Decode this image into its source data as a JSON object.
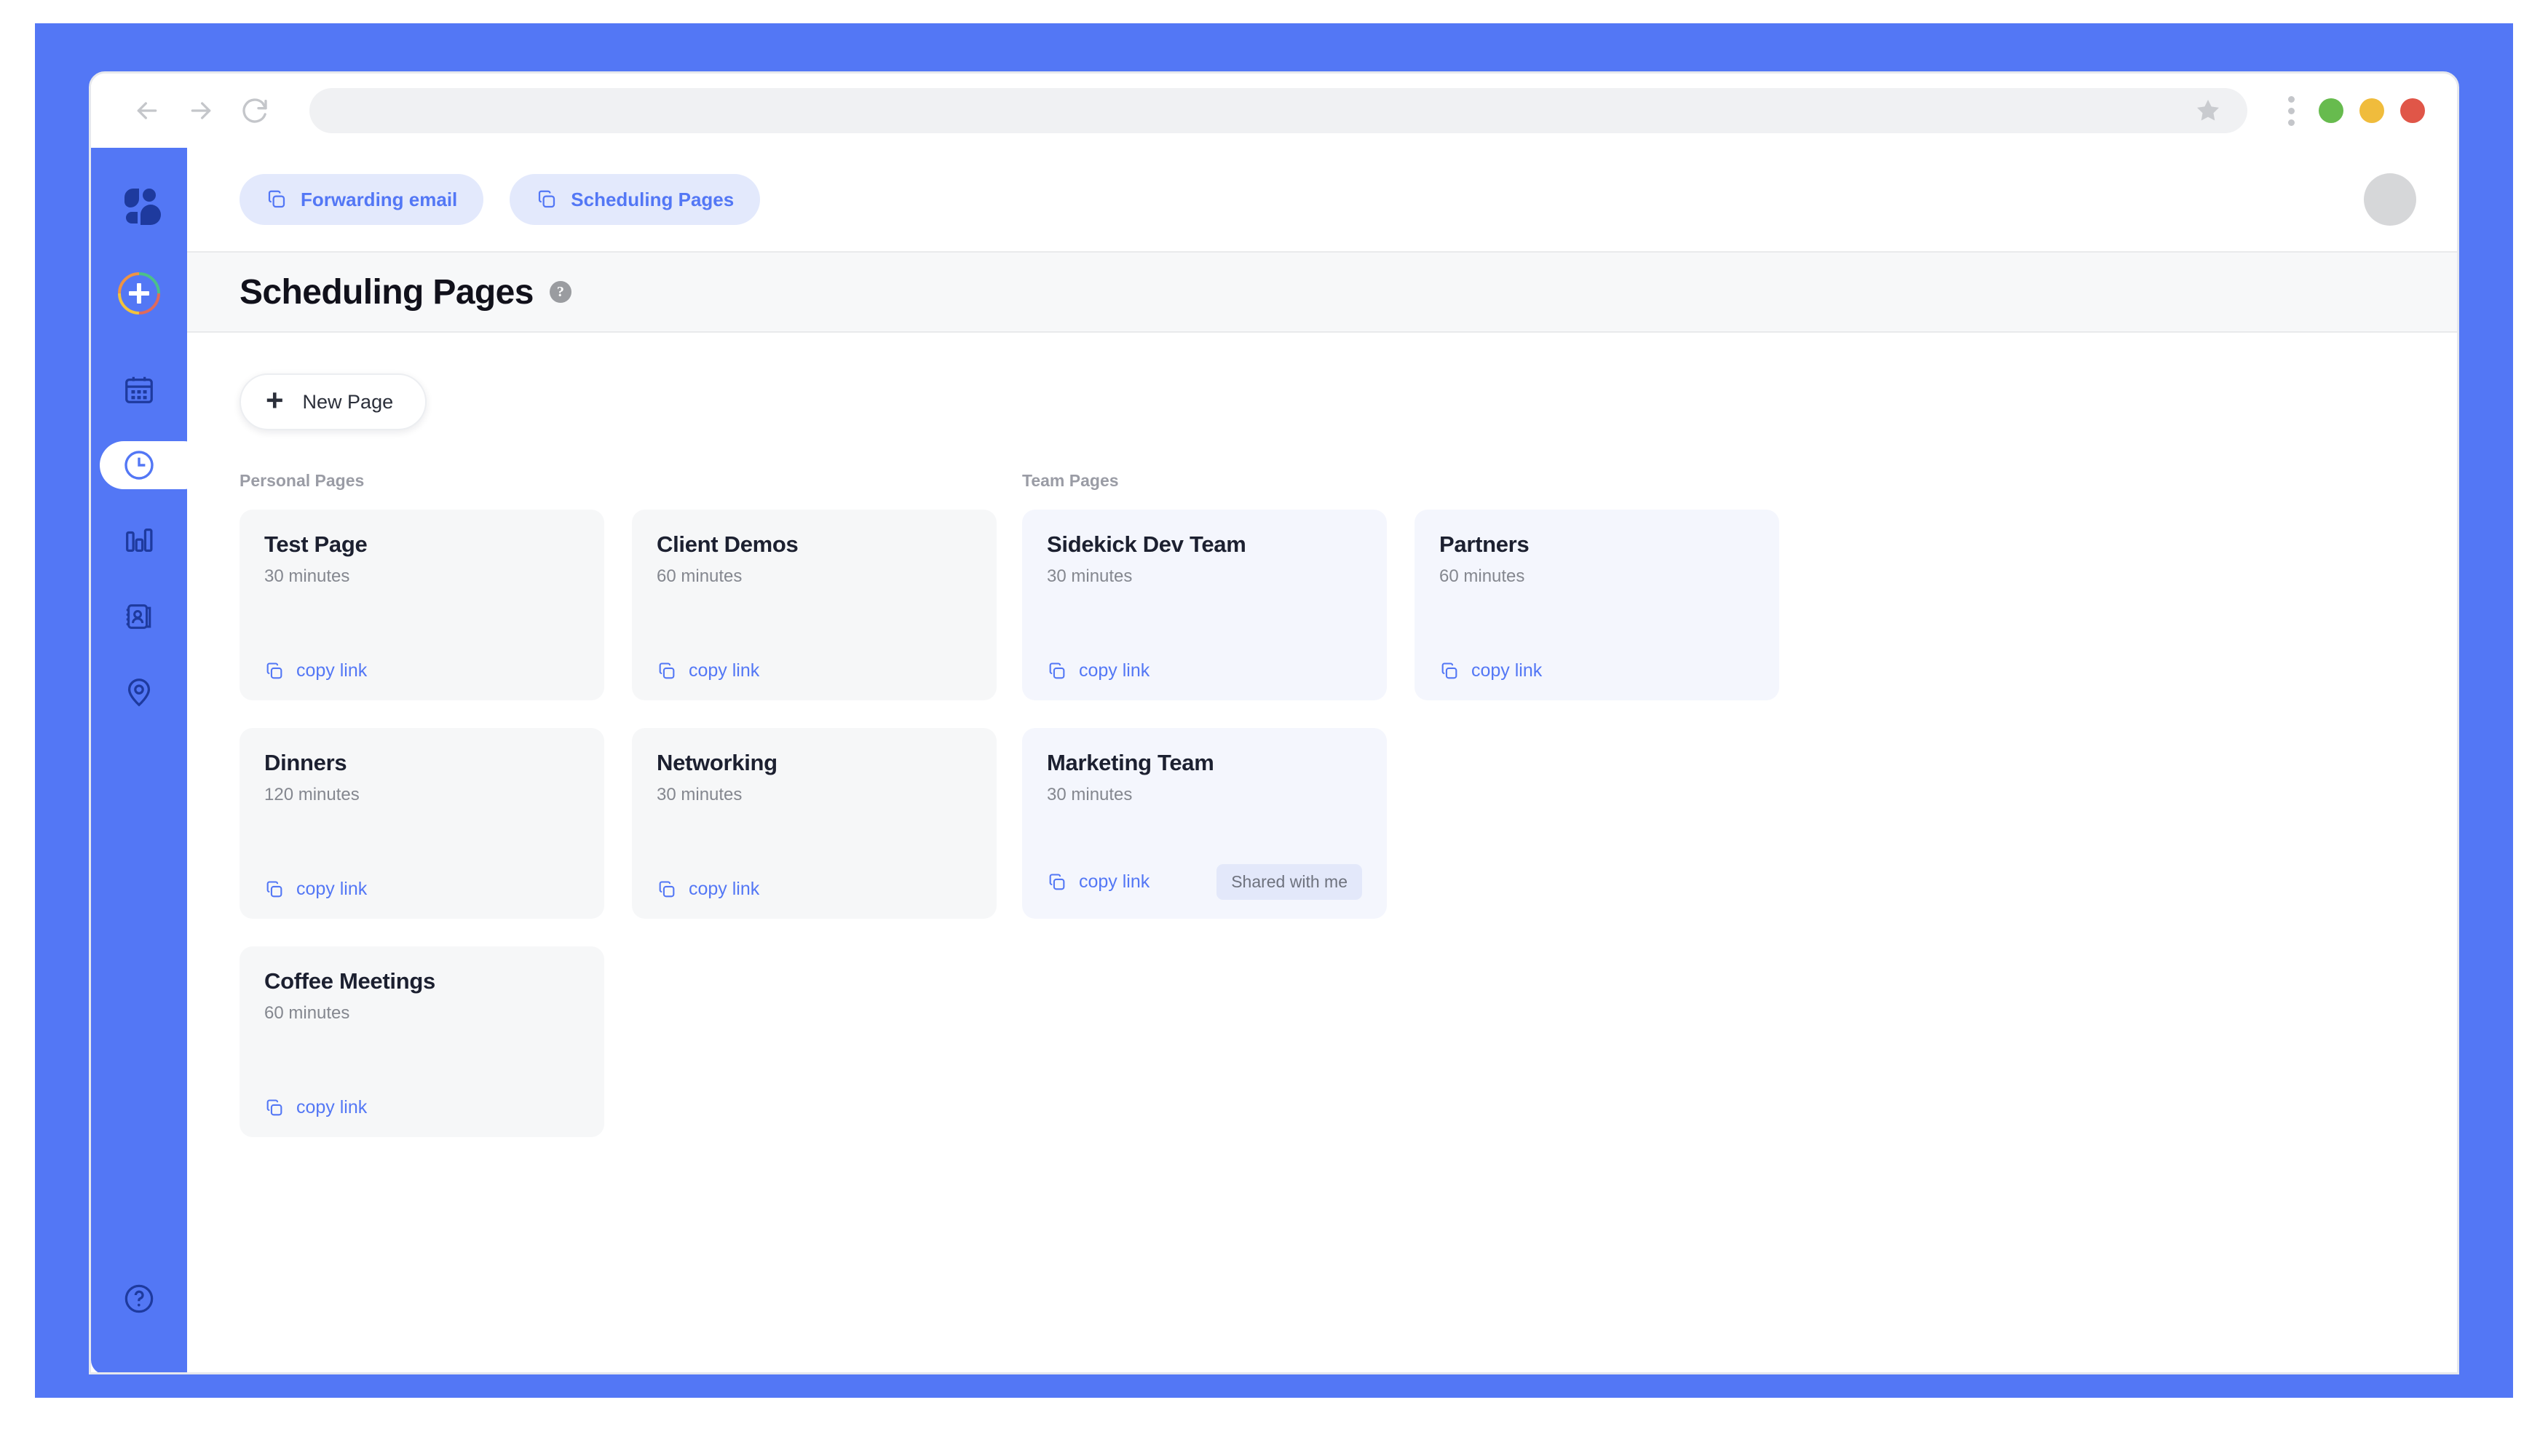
{
  "browser": {
    "back_icon": "arrow-left-icon",
    "forward_icon": "arrow-right-icon",
    "reload_icon": "reload-icon",
    "address_value": "",
    "address_placeholder": "",
    "bookmark_icon": "star-icon",
    "menu_icon": "kebab-menu-icon",
    "window_buttons": [
      {
        "name": "maximize",
        "color": "#67bb4e"
      },
      {
        "name": "minimize",
        "color": "#f0bc3c"
      },
      {
        "name": "close",
        "color": "#e05648"
      }
    ]
  },
  "sidebar": {
    "brand_icon": "app-logo-icon",
    "add_button_label": "+",
    "add_ring_colors": [
      "#4cc08a",
      "#e06a5c",
      "#f2c33c",
      "#ef9344"
    ],
    "items": [
      {
        "name": "calendar",
        "icon": "calendar-icon",
        "active": false
      },
      {
        "name": "scheduling",
        "icon": "clock-icon",
        "active": true
      },
      {
        "name": "analytics",
        "icon": "bar-chart-icon",
        "active": false
      },
      {
        "name": "contacts",
        "icon": "contacts-book-icon",
        "active": false
      },
      {
        "name": "locations",
        "icon": "location-pin-icon",
        "active": false
      }
    ],
    "help_icon": "question-circle-icon",
    "background": "#5377f5"
  },
  "topbar": {
    "pills": [
      {
        "label": "Forwarding email",
        "icon": "copy-icon"
      },
      {
        "label": "Scheduling Pages",
        "icon": "copy-icon"
      }
    ],
    "avatar": "user-avatar"
  },
  "header": {
    "title": "Scheduling Pages",
    "help_badge": "?"
  },
  "toolbar": {
    "new_page_label": "New Page",
    "new_page_icon": "plus-icon"
  },
  "columns": [
    {
      "label": "Personal Pages",
      "cards": [
        {
          "title": "Test Page",
          "duration": "30 minutes",
          "copy_label": "copy link",
          "copy_icon": "copy-icon",
          "badge": null,
          "team": false
        },
        {
          "title": "Client Demos",
          "duration": "60 minutes",
          "copy_label": "copy link",
          "copy_icon": "copy-icon",
          "badge": null,
          "team": false
        },
        {
          "title": "Dinners",
          "duration": "120 minutes",
          "copy_label": "copy link",
          "copy_icon": "copy-icon",
          "badge": null,
          "team": false
        },
        {
          "title": "Networking",
          "duration": "30 minutes",
          "copy_label": "copy link",
          "copy_icon": "copy-icon",
          "badge": null,
          "team": false
        },
        {
          "title": "Coffee Meetings",
          "duration": "60 minutes",
          "copy_label": "copy link",
          "copy_icon": "copy-icon",
          "badge": null,
          "team": false
        }
      ]
    },
    {
      "label": "Team Pages",
      "cards": [
        {
          "title": "Sidekick Dev Team",
          "duration": "30 minutes",
          "copy_label": "copy link",
          "copy_icon": "copy-icon",
          "badge": null,
          "team": true
        },
        {
          "title": "Partners",
          "duration": "60 minutes",
          "copy_label": "copy link",
          "copy_icon": "copy-icon",
          "badge": null,
          "team": true
        },
        {
          "title": "Marketing Team",
          "duration": "30 minutes",
          "copy_label": "copy link",
          "copy_icon": "copy-icon",
          "badge": "Shared with me",
          "team": true
        }
      ]
    }
  ],
  "colors": {
    "accent": "#5377f5",
    "accent_dark": "#1e3a9e",
    "card_personal": "#f6f7f8",
    "card_team": "#f4f6fd",
    "pill_bg": "#e3e9fc",
    "badge_bg": "#e3e8fa"
  }
}
